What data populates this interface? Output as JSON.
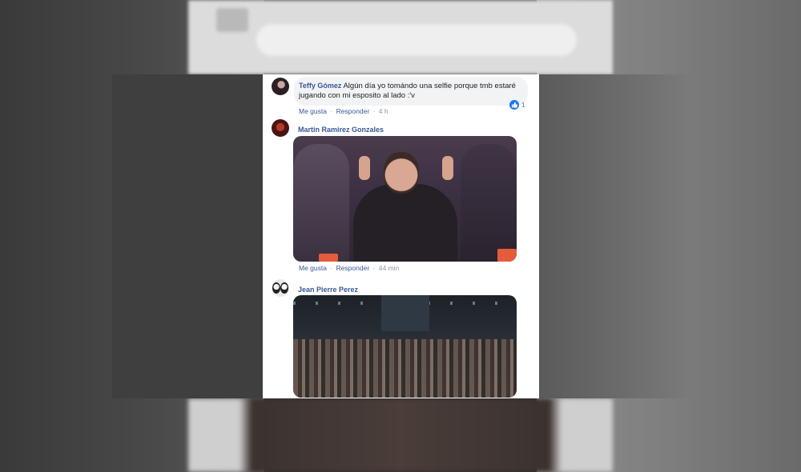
{
  "comments": [
    {
      "author": "Teffy Gómez",
      "text": "Algún día yo tomándo una selfie porque tmb estaré jugando con mi esposito al lado :'v",
      "actions": {
        "like": "Me gusta",
        "reply": "Responder",
        "separator": "·",
        "time": "4 h"
      },
      "reaction_count": "1"
    },
    {
      "author": "Martin Ramirez Gonzales",
      "actions": {
        "like": "Me gusta",
        "reply": "Responder",
        "separator": "·",
        "time": "44 min"
      }
    },
    {
      "author": "Jean Pierre Perez"
    }
  ],
  "colors": {
    "author_link": "#385898",
    "bubble_bg": "#f2f3f5",
    "like_blue": "#1877f2",
    "meta_gray": "#90949c"
  },
  "icons": [
    "thumbs-up-reaction-icon"
  ]
}
